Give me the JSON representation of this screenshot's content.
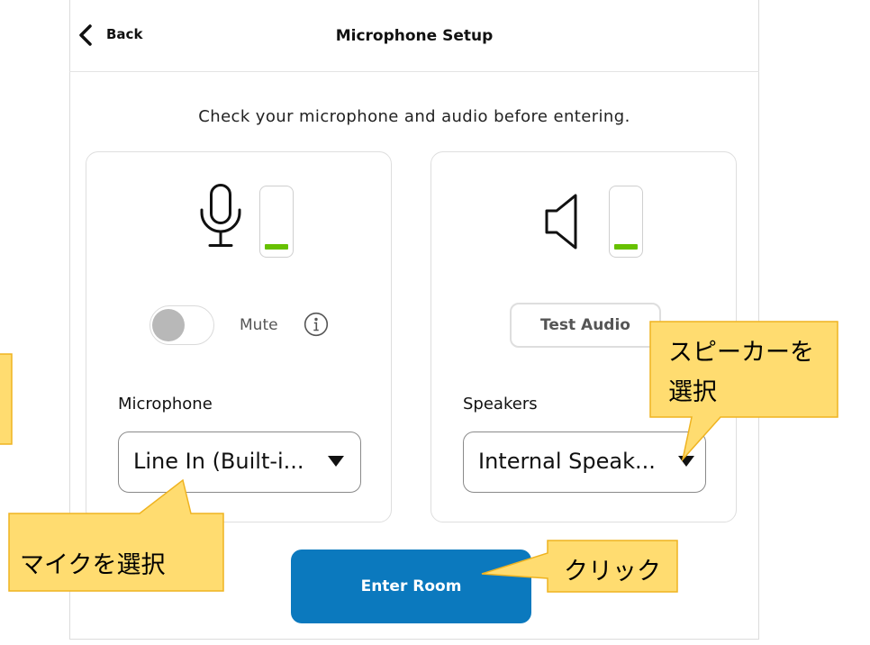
{
  "header": {
    "back_label": "Back",
    "back_icon": "chevron-left-icon",
    "title": "Microphone Setup"
  },
  "intro_text": "Check your microphone and audio before entering.",
  "microphone_card": {
    "icon": "microphone-icon",
    "input_level": 0.09,
    "mute_toggle": {
      "label": "Mute",
      "on": false,
      "info_icon": "info-icon"
    },
    "select_label": "Microphone",
    "selected_device": "Line In (Built-i...",
    "dropdown_icon": "caret-down-icon"
  },
  "speaker_card": {
    "icon": "speaker-icon",
    "output_level": 0.09,
    "test_button_label": "Test Audio",
    "select_label": "Speakers",
    "selected_device": "Internal Speak...",
    "dropdown_icon": "caret-down-icon"
  },
  "enter_button_label": "Enter Room",
  "annotations": {
    "speaker_callout": [
      "スピーカーを",
      "選択"
    ],
    "mic_callout": "マイクを選択",
    "enter_callout": "クリック"
  },
  "colors": {
    "accent": "#0b79be",
    "level_green": "#67c100",
    "callout_fill": "#ffdc70",
    "callout_border": "#efb320",
    "text": "#111111",
    "secondary_text": "#555555",
    "border": "#dcdcdc"
  }
}
